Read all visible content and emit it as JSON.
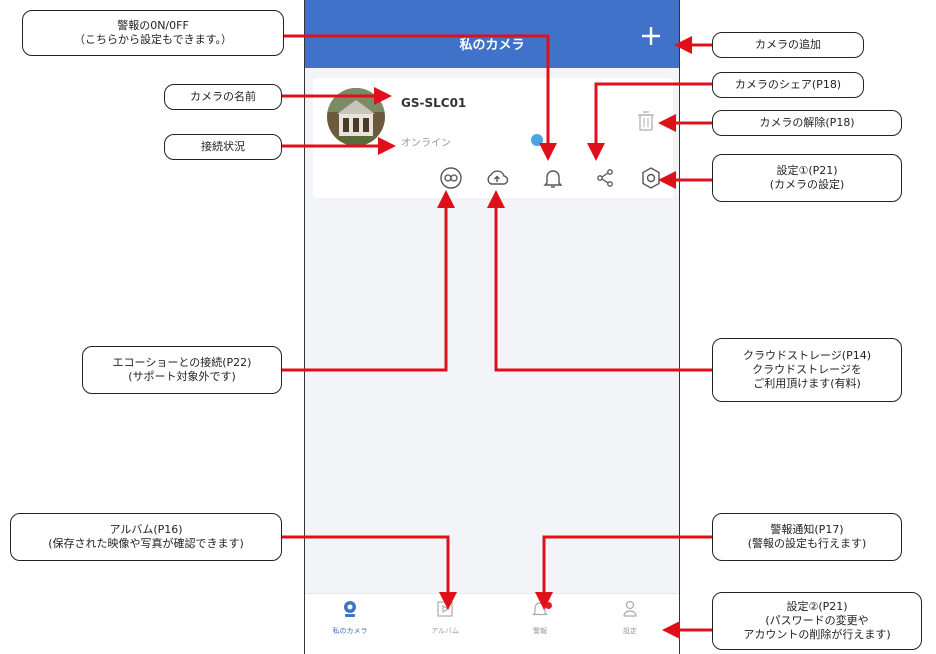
{
  "app": {
    "header_title": "私のカメラ",
    "add_icon": "plus-icon"
  },
  "camera": {
    "name": "GS-SLC01",
    "status": "オンライン"
  },
  "tabs": [
    {
      "label": "私のカメラ",
      "icon": "camera-icon",
      "active": true
    },
    {
      "label": "アルバム",
      "icon": "album-icon",
      "active": false
    },
    {
      "label": "警報",
      "icon": "bell-icon",
      "active": false
    },
    {
      "label": "設定",
      "icon": "person-icon",
      "active": false
    }
  ],
  "callouts": {
    "alarm_toggle": {
      "line1": "警報の0N/0FF",
      "line2": "（こちらから設定もできます。）"
    },
    "add_camera": {
      "line1": "カメラの追加"
    },
    "camera_name": {
      "line1": "カメラの名前"
    },
    "share": {
      "line1": "カメラのシェア(P18)"
    },
    "remove": {
      "line1": "カメラの解除(P18)"
    },
    "connection": {
      "line1": "接続状況"
    },
    "settings1": {
      "line1": "設定①(P21)",
      "line2": "(カメラの設定)"
    },
    "echo": {
      "line1": "エコーショーとの接続(P22)",
      "line2": "(サポート対象外です)"
    },
    "cloud": {
      "line1": "クラウドストレージ(P14)",
      "line2": "クラウドストレージを",
      "line3": "ご利用頂けます(有料)"
    },
    "album": {
      "line1": "アルバム(P16)",
      "line2": "(保存された映像や写真が確認できます)"
    },
    "alert": {
      "line1": "警報通知(P17)",
      "line2": "(警報の設定も行えます)"
    },
    "settings2": {
      "line1": "設定②(P21)",
      "line2": "(パスワードの変更や",
      "line3": "アカウントの削除が行えます)"
    }
  },
  "colors": {
    "header": "#3f72c8",
    "arrow": "#e0101a",
    "badge": "#e02020"
  }
}
